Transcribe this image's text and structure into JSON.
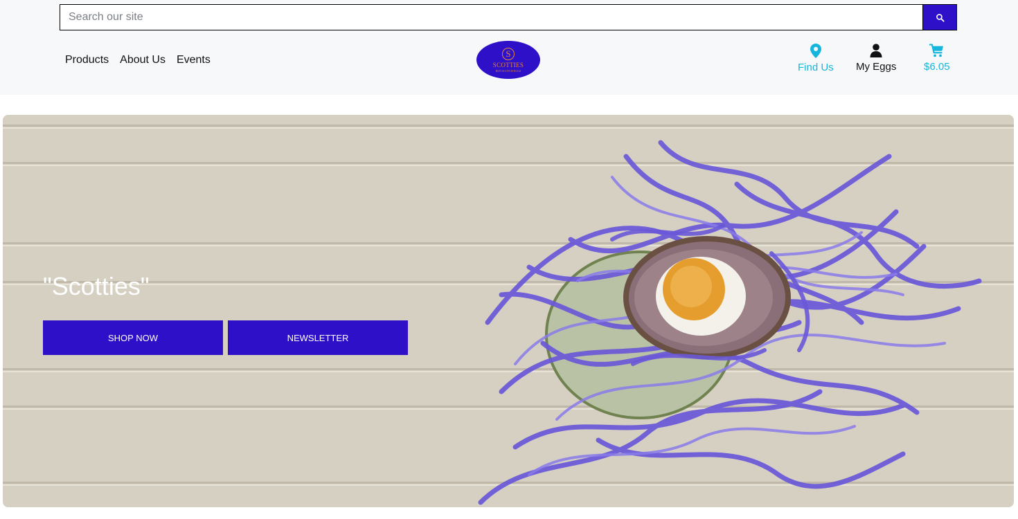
{
  "search": {
    "placeholder": "Search our site",
    "button_icon": "search-icon"
  },
  "nav": {
    "items": [
      {
        "label": "Products"
      },
      {
        "label": "About Us"
      },
      {
        "label": "Events"
      }
    ]
  },
  "logo": {
    "letter": "S",
    "name": "SCOTTIES",
    "tagline": "RUN SCOTCH EGGS"
  },
  "utility": {
    "find_us": {
      "label": "Find Us",
      "icon": "map-pin-icon"
    },
    "my_eggs": {
      "label": "My Eggs",
      "icon": "user-icon"
    },
    "cart": {
      "label": "$6.05",
      "icon": "shopping-cart-icon"
    }
  },
  "hero": {
    "title": "\"Scotties\"",
    "shop_now_label": "Shop Now",
    "newsletter_label": "Newsletter"
  },
  "colors": {
    "brand": "#2f10c9",
    "accent_cyan": "#16b6dc",
    "logo_gold": "#e2873e",
    "header_bg": "#f7f8fa"
  }
}
